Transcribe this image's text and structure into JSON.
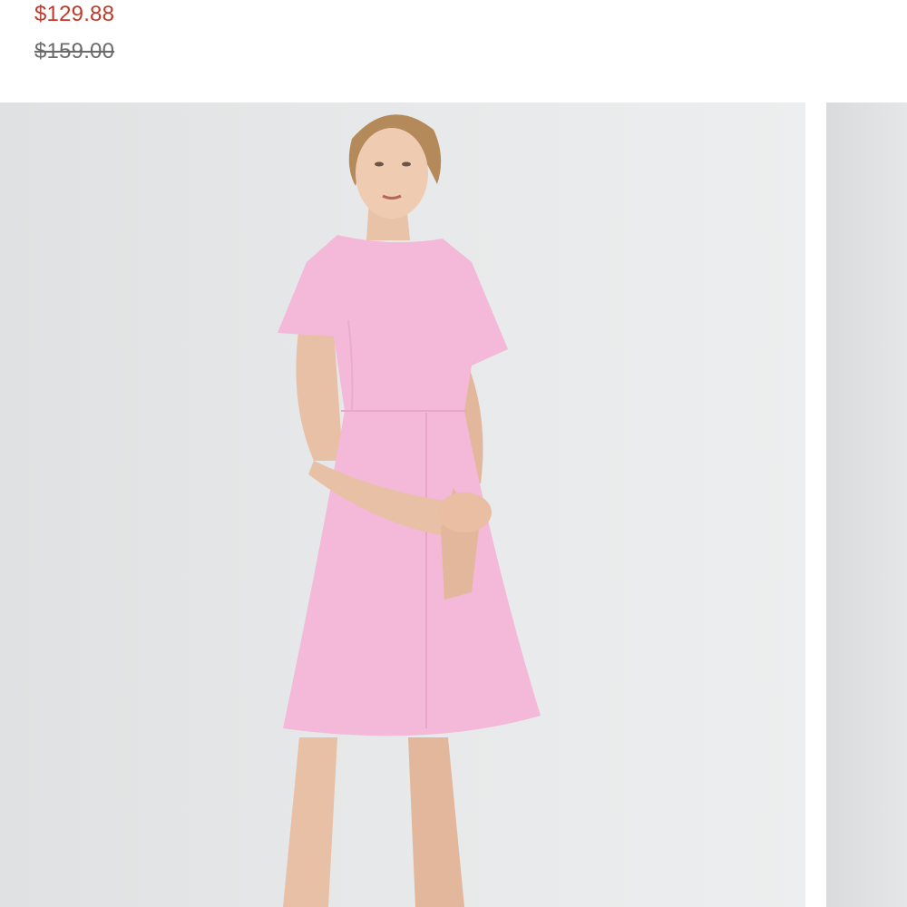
{
  "product": {
    "sale_price": "$129.88",
    "original_price": "$159.00"
  },
  "colors": {
    "sale_price": "#c0392b",
    "original_price": "#6b6b6b",
    "dress": "#f4b8d8",
    "background": "#e6e8e9"
  },
  "gallery": {
    "main_image_icon": "product-photo-pink-dress",
    "next_image_icon": "product-photo-partial"
  }
}
